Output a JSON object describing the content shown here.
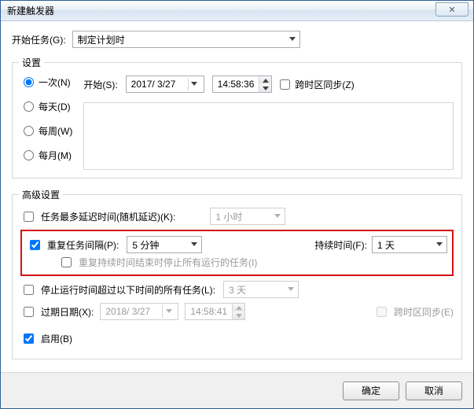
{
  "title": "新建触发器",
  "close_glyph": "✕",
  "startTask": {
    "label": "开始任务(G):",
    "value": "制定计划时"
  },
  "settings": {
    "legend": "设置",
    "radios": {
      "once": "一次(N)",
      "daily": "每天(D)",
      "weekly": "每周(W)",
      "monthly": "每月(M)"
    },
    "start_label": "开始(S):",
    "date": "2017/ 3/27",
    "time": "14:58:36",
    "sync_tz": "跨时区同步(Z)"
  },
  "advanced": {
    "legend": "高级设置",
    "delay_label": "任务最多延迟时间(随机延迟)(K):",
    "delay_value": "1 小时",
    "repeat_label": "重复任务间隔(P):",
    "repeat_value": "5 分钟",
    "duration_label": "持续时间(F):",
    "duration_value": "1 天",
    "stop_all_label": "重复持续时间结束时停止所有运行的任务(I)",
    "stop_after_label": "停止运行时间超过以下时间的所有任务(L):",
    "stop_after_value": "3 天",
    "expire_label": "过期日期(X):",
    "expire_date": "2018/ 3/27",
    "expire_time": "14:58:41",
    "expire_sync": "跨时区同步(E)",
    "enable_label": "启用(B)"
  },
  "buttons": {
    "ok": "确定",
    "cancel": "取消"
  }
}
